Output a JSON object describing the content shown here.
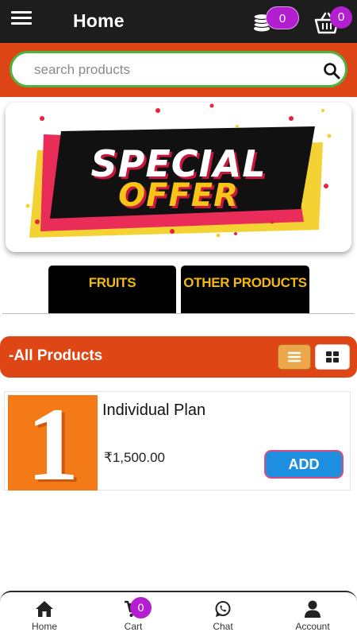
{
  "header": {
    "title": "Home",
    "coins_count": "0",
    "cart_count": "0"
  },
  "search": {
    "placeholder": "search products"
  },
  "banner": {
    "line1": "SPECIAL",
    "line2": "OFFER"
  },
  "categories": [
    {
      "label": "FRUITS"
    },
    {
      "label": "OTHER PRODUCTS"
    }
  ],
  "section": {
    "title": "-All Products"
  },
  "products": [
    {
      "name": "Individual Plan",
      "price": "₹1,500.00",
      "thumb_text": "1",
      "add_label": "ADD"
    }
  ],
  "bottom_nav": {
    "items": [
      {
        "label": "Home",
        "icon": "home-icon"
      },
      {
        "label": "Cart",
        "icon": "cart-icon"
      },
      {
        "label": "Chat",
        "icon": "whatsapp-icon"
      },
      {
        "label": "Account",
        "icon": "user-icon"
      }
    ],
    "cart_badge": "0"
  },
  "colors": {
    "header_bg": "#1d1d1d",
    "brand_orange": "#dd4516",
    "search_border": "#4fb33e",
    "badge": "#b31ed0",
    "tab_text": "#f3b90c",
    "add_button": "#1e8fe0"
  }
}
